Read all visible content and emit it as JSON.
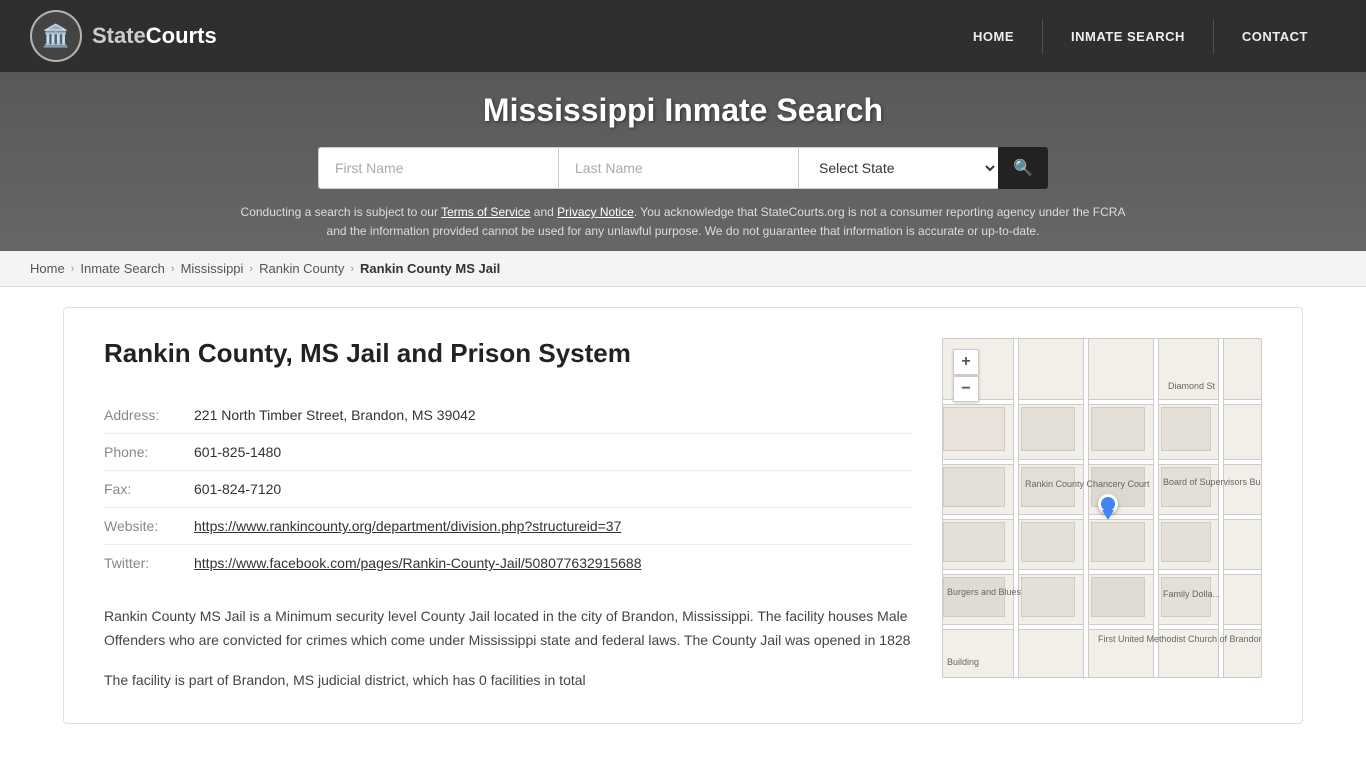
{
  "site": {
    "name": "StateCourts",
    "logo_icon": "🏛️"
  },
  "nav": {
    "home_label": "HOME",
    "inmate_search_label": "INMATE SEARCH",
    "contact_label": "CONTACT"
  },
  "header": {
    "title": "Mississippi Inmate Search",
    "search": {
      "first_name_placeholder": "First Name",
      "last_name_placeholder": "Last Name",
      "state_label": "Select State",
      "search_icon": "🔍"
    },
    "disclaimer": "Conducting a search is subject to our Terms of Service and Privacy Notice. You acknowledge that StateCourts.org is not a consumer reporting agency under the FCRA and the information provided cannot be used for any unlawful purpose. We do not guarantee that information is accurate or up-to-date."
  },
  "breadcrumb": {
    "home": "Home",
    "inmate_search": "Inmate Search",
    "state": "Mississippi",
    "county": "Rankin County",
    "current": "Rankin County MS Jail"
  },
  "facility": {
    "heading": "Rankin County, MS Jail and Prison System",
    "address_label": "Address:",
    "address_value": "221 North Timber Street, Brandon, MS 39042",
    "phone_label": "Phone:",
    "phone_value": "601-825-1480",
    "fax_label": "Fax:",
    "fax_value": "601-824-7120",
    "website_label": "Website:",
    "website_url": "https://www.rankincounty.org/department/division.php?structureid=37",
    "website_text": "https://www.rankincounty.org/department/division.php?structureid=37",
    "twitter_label": "Twitter:",
    "twitter_url": "https://www.facebook.com/pages/Rankin-County-Jail/508077632915688",
    "twitter_text": "https://www.facebook.com/pages/Rankin-County-Jail/508077632915688",
    "description1": "Rankin County MS Jail is a Minimum security level County Jail located in the city of Brandon, Mississippi. The facility houses Male Offenders who are convicted for crimes which come under Mississippi state and federal laws. The County Jail was opened in 1828",
    "description2": "The facility is part of Brandon, MS judicial district, which has 0 facilities in total"
  },
  "map": {
    "zoom_in": "+",
    "zoom_out": "−",
    "labels": {
      "diamond_st": "Diamond St",
      "rankin_county": "Rankin County\nChancery Court",
      "board_supervisors": "Board of Supervisors\nBuilding",
      "burgers_blues": "Burgers and Blues",
      "family_dollar": "Family Dolla...",
      "first_united": "First United Methodist\nChurch of Brandon",
      "building": "Building"
    }
  }
}
